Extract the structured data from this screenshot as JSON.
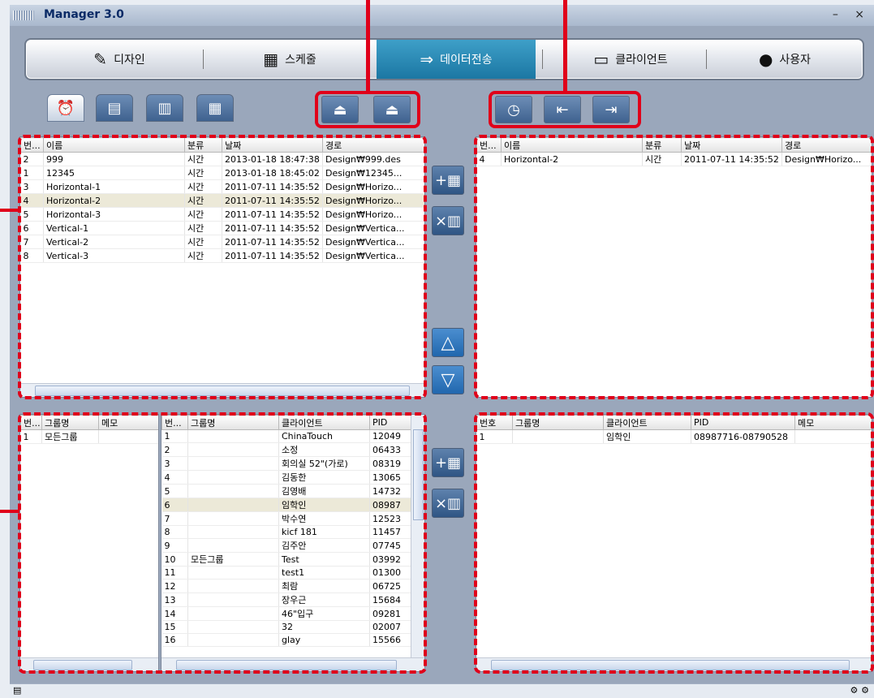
{
  "window": {
    "title": "Manager 3.0",
    "controls": "– ×"
  },
  "nav": [
    {
      "label": "디자인",
      "icon": "design-icon",
      "glyph": "✎"
    },
    {
      "label": "스케줄",
      "icon": "calendar-icon",
      "glyph": "▦"
    },
    {
      "label": "데이터전송",
      "icon": "data-transfer-icon",
      "glyph": "⇒"
    },
    {
      "label": "클라이언트",
      "icon": "monitor-icon",
      "glyph": "▭"
    },
    {
      "label": "사용자",
      "icon": "user-icon",
      "glyph": "●"
    }
  ],
  "toolbar": {
    "view_tabs": [
      "alarm-clock-icon",
      "list-view-icon",
      "column-view-icon",
      "grid-view-icon"
    ],
    "group_a": [
      "transfer-up-icon",
      "transfer-down-icon"
    ],
    "group_b": [
      "clock-icon",
      "import-icon",
      "export-icon"
    ]
  },
  "schedule_list": {
    "columns": [
      "번...",
      "이름",
      "분류",
      "날짜",
      "경로"
    ],
    "rows": [
      [
        "2",
        "999",
        "시간",
        "2013-01-18 18:47:38",
        "Design₩999.des"
      ],
      [
        "1",
        "12345",
        "시간",
        "2013-01-18 18:45:02",
        "Design₩12345..."
      ],
      [
        "3",
        "Horizontal-1",
        "시간",
        "2011-07-11 14:35:52",
        "Design₩Horizo..."
      ],
      [
        "4",
        "Horizontal-2",
        "시간",
        "2011-07-11 14:35:52",
        "Design₩Horizo..."
      ],
      [
        "5",
        "Horizontal-3",
        "시간",
        "2011-07-11 14:35:52",
        "Design₩Horizo..."
      ],
      [
        "6",
        "Vertical-1",
        "시간",
        "2011-07-11 14:35:52",
        "Design₩Vertica..."
      ],
      [
        "7",
        "Vertical-2",
        "시간",
        "2011-07-11 14:35:52",
        "Design₩Vertica..."
      ],
      [
        "8",
        "Vertical-3",
        "시간",
        "2011-07-11 14:35:52",
        "Design₩Vertica..."
      ]
    ]
  },
  "selected_schedule": {
    "columns": [
      "번...",
      "이름",
      "분류",
      "날짜",
      "경로"
    ],
    "rows": [
      [
        "4",
        "Horizontal-2",
        "시간",
        "2011-07-11 14:35:52",
        "Design₩Horizo..."
      ]
    ]
  },
  "groups": {
    "columns": [
      "번...",
      "그룹명",
      "메모"
    ],
    "rows": [
      [
        "1",
        "모든그룹",
        ""
      ]
    ]
  },
  "clients": {
    "columns": [
      "번...",
      "그룹명",
      "클라이언트",
      "PID"
    ],
    "rows": [
      [
        "1",
        "",
        "ChinaTouch",
        "12049"
      ],
      [
        "2",
        "",
        "소정",
        "06433"
      ],
      [
        "3",
        "",
        "회의실 52\"(가로)",
        "08319"
      ],
      [
        "4",
        "",
        "김동한",
        "13065"
      ],
      [
        "5",
        "",
        "김영배",
        "14732"
      ],
      [
        "6",
        "",
        "임학인",
        "08987"
      ],
      [
        "7",
        "",
        "박수연",
        "12523"
      ],
      [
        "8",
        "",
        "kicf 181",
        "11457"
      ],
      [
        "9",
        "",
        "김주안",
        "07745"
      ],
      [
        "10",
        "모든그룹",
        "Test",
        "03992"
      ],
      [
        "11",
        "",
        "test1",
        "01300"
      ],
      [
        "12",
        "",
        "최람",
        "06725"
      ],
      [
        "13",
        "",
        "장우근",
        "15684"
      ],
      [
        "14",
        "",
        "46\"입구",
        "09281"
      ],
      [
        "15",
        "",
        "32",
        "02007"
      ],
      [
        "16",
        "",
        "glay",
        "15566"
      ]
    ]
  },
  "selected_clients": {
    "columns": [
      "번호",
      "그룹명",
      "클라이언트",
      "PID",
      "메모"
    ],
    "rows": [
      [
        "1",
        "",
        "임학인",
        "08987716-08790528",
        ""
      ]
    ]
  },
  "actions": {
    "add_glyph": "+▦",
    "delete_glyph": "×▥",
    "up_glyph": "△",
    "down_glyph": "▽"
  },
  "status": {
    "left_glyph": "▤",
    "right_glyph": "⚙ ⚙"
  }
}
